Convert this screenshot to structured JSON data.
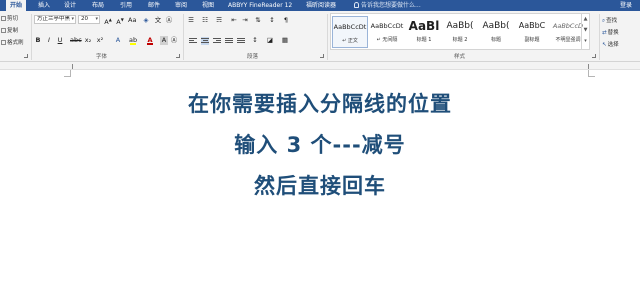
{
  "tabs": [
    {
      "label": "开始",
      "active": true
    },
    {
      "label": "插入",
      "active": false
    },
    {
      "label": "设计",
      "active": false
    },
    {
      "label": "布局",
      "active": false
    },
    {
      "label": "引用",
      "active": false
    },
    {
      "label": "邮件",
      "active": false
    },
    {
      "label": "审阅",
      "active": false
    },
    {
      "label": "视图",
      "active": false
    },
    {
      "label": "ABBYY FineReader 12",
      "active": false
    },
    {
      "label": "福昕阅读器",
      "active": false
    }
  ],
  "tell_me": "告诉我您想要做什么...",
  "login": "登录",
  "clipboard": {
    "cut": "剪切",
    "copy": "复制",
    "format_painter": "格式刷"
  },
  "font": {
    "name": "方正兰亭中黑",
    "size": "20",
    "group_label": "字体"
  },
  "paragraph": {
    "group_label": "段落"
  },
  "styles": {
    "group_label": "样式",
    "items": [
      {
        "sample": "AaBbCcDt",
        "name": "↵ 正文"
      },
      {
        "sample": "AaBbCcDt",
        "name": "↵ 无间隔"
      },
      {
        "sample": "AaBl",
        "name": "标题 1"
      },
      {
        "sample": "AaBb(",
        "name": "标题 2"
      },
      {
        "sample": "AaBb(",
        "name": "标题"
      },
      {
        "sample": "AaBbC",
        "name": "副标题"
      },
      {
        "sample": "AaBbCcD",
        "name": "不明显强调"
      }
    ]
  },
  "editing": {
    "find": "查找",
    "replace": "替换",
    "select": "选择"
  },
  "document": {
    "lines": [
      "在你需要插入分隔线的位置",
      "输入 3 个---减号",
      "然后直接回车"
    ]
  },
  "colors": {
    "brand": "#2b579a",
    "text": "#1f4e79",
    "font_color_bar": "#c00000",
    "highlight_bar": "#ffff00"
  }
}
